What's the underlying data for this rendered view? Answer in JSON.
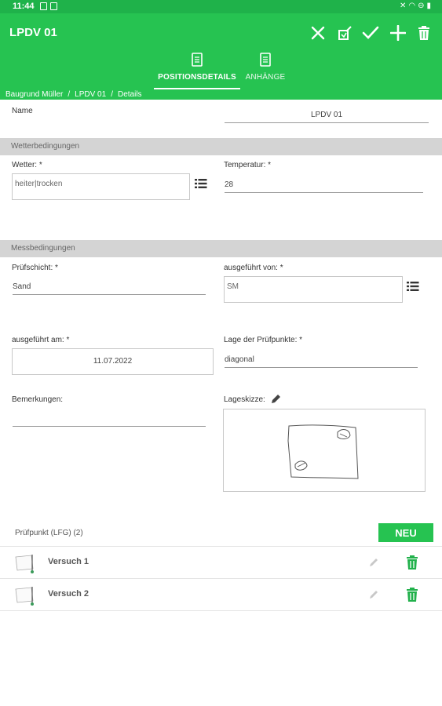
{
  "status_bar": {
    "time": "11:44"
  },
  "app_bar": {
    "title": "LPDV 01"
  },
  "toolbar": {
    "close_icon": "close-icon",
    "paint_icon": "brush-icon",
    "check_icon": "check-icon",
    "add_icon": "plus-icon",
    "delete_icon": "trash-icon"
  },
  "tabs": [
    {
      "label": "POSITIONSDETAILS",
      "active": true
    },
    {
      "label": "ANHÄNGE",
      "active": false
    }
  ],
  "breadcrumb": [
    "Baugrund Müller",
    "/",
    "LPDV 01",
    "/",
    "Details"
  ],
  "name_field": {
    "label": "Name",
    "value": "LPDV 01"
  },
  "sections": {
    "weather": "Wetterbedingungen",
    "measurement": "Messbedingungen"
  },
  "weather": {
    "wetter_label": "Wetter: *",
    "wetter_value": "heiter|trocken",
    "temp_label": "Temperatur: *",
    "temp_value": "28"
  },
  "measure": {
    "layer_label": "Prüfschicht: *",
    "layer_value": "Sand",
    "executed_by_label": "ausgeführt von: *",
    "executed_by_value": "SM",
    "executed_on_label": "ausgeführt am: *",
    "executed_on_value": "11.07.2022",
    "position_label": "Lage der Prüfpunkte: *",
    "position_value": "diagonal",
    "remarks_label": "Bemerkungen:",
    "remarks_value": "",
    "sketch_label": "Lageskizze:"
  },
  "pruefpunkte": {
    "title": "Prüfpunkt (LFG) (2)",
    "new_button": "NEU",
    "items": [
      {
        "label": "Versuch 1"
      },
      {
        "label": "Versuch 2"
      }
    ]
  },
  "colors": {
    "accent": "#26c351",
    "section_bg": "#d4d4d4"
  }
}
